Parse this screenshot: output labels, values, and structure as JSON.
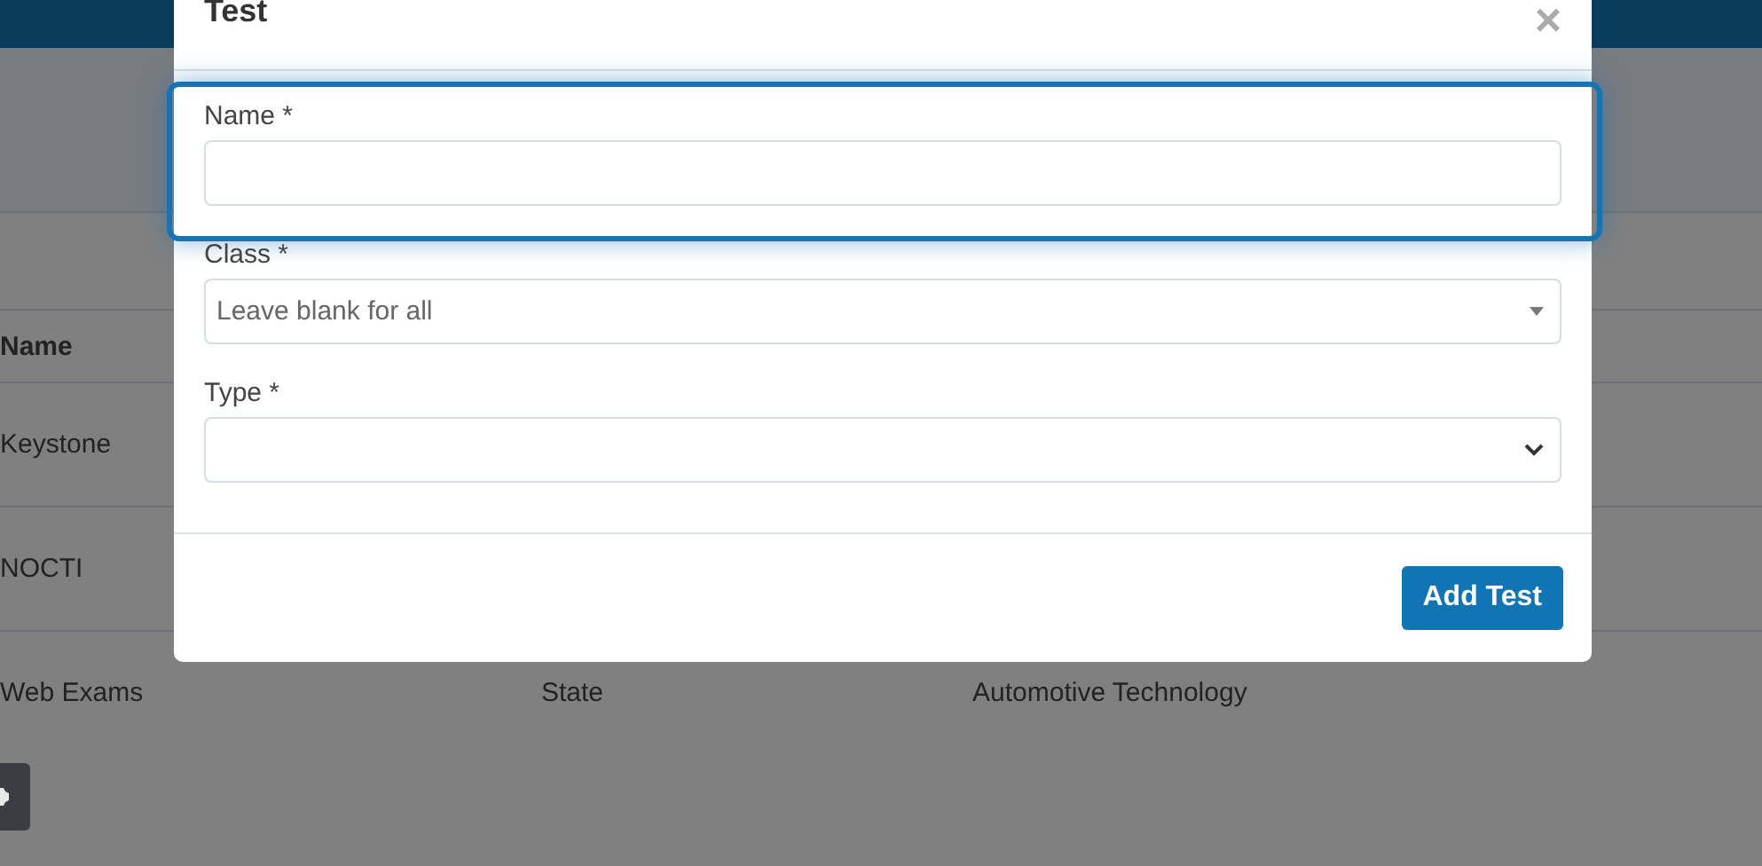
{
  "background": {
    "table": {
      "columns": [
        "Name"
      ],
      "rows": [
        [
          "Keystone"
        ],
        [
          "NOCTI"
        ],
        [
          "Web Exams",
          "State",
          "Automotive Technology"
        ]
      ]
    }
  },
  "modal": {
    "title": "Test",
    "close": "×",
    "fields": [
      {
        "kind": "input",
        "label": "Name *",
        "highlighted": true
      },
      {
        "kind": "combobox",
        "label": "Class *",
        "placeholder": "Leave blank for all",
        "highlighted": false
      },
      {
        "kind": "select",
        "label": "Type *",
        "highlighted": false
      }
    ],
    "button": "Add Test"
  }
}
